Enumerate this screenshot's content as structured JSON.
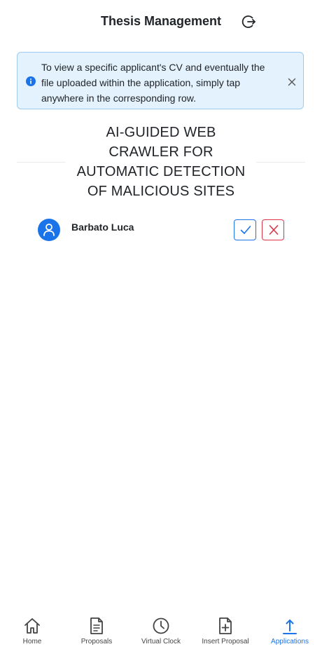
{
  "header": {
    "title": "Thesis Management",
    "logout_icon": "logout-icon"
  },
  "alert": {
    "icon": "info-icon",
    "text": "To view a specific applicant's CV and eventually the file uploaded within the application, simply tap anywhere in the corresponding row.",
    "close_icon": "close-icon"
  },
  "proposal": {
    "title": "AI-GUIDED WEB CRAWLER FOR AUTOMATIC DETECTION OF MALICIOUS SITES"
  },
  "applications": [
    {
      "name": "Barbato Luca",
      "avatar_icon": "user-icon",
      "accept_icon": "check-icon",
      "reject_icon": "x-icon"
    }
  ],
  "nav": {
    "items": [
      {
        "label": "Home",
        "icon": "home-icon"
      },
      {
        "label": "Proposals",
        "icon": "document-icon"
      },
      {
        "label": "Virtual Clock",
        "icon": "clock-icon"
      },
      {
        "label": "Insert Proposal",
        "icon": "file-plus-icon"
      },
      {
        "label": "Applications",
        "icon": "upload-arrow-icon",
        "active": true
      }
    ]
  },
  "colors": {
    "accent": "#1a73e8",
    "danger": "#dc3545",
    "alert_bg": "#e3f2fd"
  }
}
